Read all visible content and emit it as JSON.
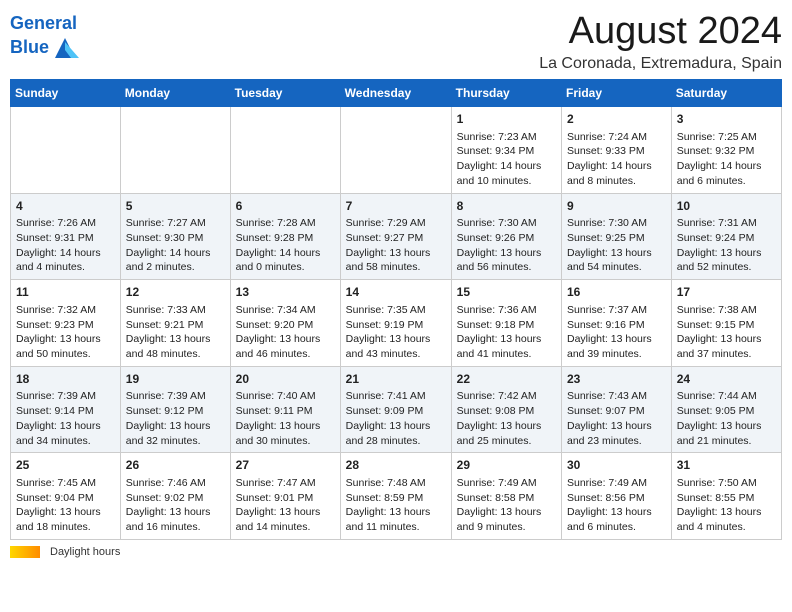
{
  "header": {
    "logo_line1": "General",
    "logo_line2": "Blue",
    "month_year": "August 2024",
    "location": "La Coronada, Extremadura, Spain"
  },
  "weekdays": [
    "Sunday",
    "Monday",
    "Tuesday",
    "Wednesday",
    "Thursday",
    "Friday",
    "Saturday"
  ],
  "weeks": [
    [
      {
        "day": "",
        "info": ""
      },
      {
        "day": "",
        "info": ""
      },
      {
        "day": "",
        "info": ""
      },
      {
        "day": "",
        "info": ""
      },
      {
        "day": "1",
        "info": "Sunrise: 7:23 AM\nSunset: 9:34 PM\nDaylight: 14 hours and 10 minutes."
      },
      {
        "day": "2",
        "info": "Sunrise: 7:24 AM\nSunset: 9:33 PM\nDaylight: 14 hours and 8 minutes."
      },
      {
        "day": "3",
        "info": "Sunrise: 7:25 AM\nSunset: 9:32 PM\nDaylight: 14 hours and 6 minutes."
      }
    ],
    [
      {
        "day": "4",
        "info": "Sunrise: 7:26 AM\nSunset: 9:31 PM\nDaylight: 14 hours and 4 minutes."
      },
      {
        "day": "5",
        "info": "Sunrise: 7:27 AM\nSunset: 9:30 PM\nDaylight: 14 hours and 2 minutes."
      },
      {
        "day": "6",
        "info": "Sunrise: 7:28 AM\nSunset: 9:28 PM\nDaylight: 14 hours and 0 minutes."
      },
      {
        "day": "7",
        "info": "Sunrise: 7:29 AM\nSunset: 9:27 PM\nDaylight: 13 hours and 58 minutes."
      },
      {
        "day": "8",
        "info": "Sunrise: 7:30 AM\nSunset: 9:26 PM\nDaylight: 13 hours and 56 minutes."
      },
      {
        "day": "9",
        "info": "Sunrise: 7:30 AM\nSunset: 9:25 PM\nDaylight: 13 hours and 54 minutes."
      },
      {
        "day": "10",
        "info": "Sunrise: 7:31 AM\nSunset: 9:24 PM\nDaylight: 13 hours and 52 minutes."
      }
    ],
    [
      {
        "day": "11",
        "info": "Sunrise: 7:32 AM\nSunset: 9:23 PM\nDaylight: 13 hours and 50 minutes."
      },
      {
        "day": "12",
        "info": "Sunrise: 7:33 AM\nSunset: 9:21 PM\nDaylight: 13 hours and 48 minutes."
      },
      {
        "day": "13",
        "info": "Sunrise: 7:34 AM\nSunset: 9:20 PM\nDaylight: 13 hours and 46 minutes."
      },
      {
        "day": "14",
        "info": "Sunrise: 7:35 AM\nSunset: 9:19 PM\nDaylight: 13 hours and 43 minutes."
      },
      {
        "day": "15",
        "info": "Sunrise: 7:36 AM\nSunset: 9:18 PM\nDaylight: 13 hours and 41 minutes."
      },
      {
        "day": "16",
        "info": "Sunrise: 7:37 AM\nSunset: 9:16 PM\nDaylight: 13 hours and 39 minutes."
      },
      {
        "day": "17",
        "info": "Sunrise: 7:38 AM\nSunset: 9:15 PM\nDaylight: 13 hours and 37 minutes."
      }
    ],
    [
      {
        "day": "18",
        "info": "Sunrise: 7:39 AM\nSunset: 9:14 PM\nDaylight: 13 hours and 34 minutes."
      },
      {
        "day": "19",
        "info": "Sunrise: 7:39 AM\nSunset: 9:12 PM\nDaylight: 13 hours and 32 minutes."
      },
      {
        "day": "20",
        "info": "Sunrise: 7:40 AM\nSunset: 9:11 PM\nDaylight: 13 hours and 30 minutes."
      },
      {
        "day": "21",
        "info": "Sunrise: 7:41 AM\nSunset: 9:09 PM\nDaylight: 13 hours and 28 minutes."
      },
      {
        "day": "22",
        "info": "Sunrise: 7:42 AM\nSunset: 9:08 PM\nDaylight: 13 hours and 25 minutes."
      },
      {
        "day": "23",
        "info": "Sunrise: 7:43 AM\nSunset: 9:07 PM\nDaylight: 13 hours and 23 minutes."
      },
      {
        "day": "24",
        "info": "Sunrise: 7:44 AM\nSunset: 9:05 PM\nDaylight: 13 hours and 21 minutes."
      }
    ],
    [
      {
        "day": "25",
        "info": "Sunrise: 7:45 AM\nSunset: 9:04 PM\nDaylight: 13 hours and 18 minutes."
      },
      {
        "day": "26",
        "info": "Sunrise: 7:46 AM\nSunset: 9:02 PM\nDaylight: 13 hours and 16 minutes."
      },
      {
        "day": "27",
        "info": "Sunrise: 7:47 AM\nSunset: 9:01 PM\nDaylight: 13 hours and 14 minutes."
      },
      {
        "day": "28",
        "info": "Sunrise: 7:48 AM\nSunset: 8:59 PM\nDaylight: 13 hours and 11 minutes."
      },
      {
        "day": "29",
        "info": "Sunrise: 7:49 AM\nSunset: 8:58 PM\nDaylight: 13 hours and 9 minutes."
      },
      {
        "day": "30",
        "info": "Sunrise: 7:49 AM\nSunset: 8:56 PM\nDaylight: 13 hours and 6 minutes."
      },
      {
        "day": "31",
        "info": "Sunrise: 7:50 AM\nSunset: 8:55 PM\nDaylight: 13 hours and 4 minutes."
      }
    ]
  ],
  "footer": {
    "daylight_label": "Daylight hours"
  }
}
